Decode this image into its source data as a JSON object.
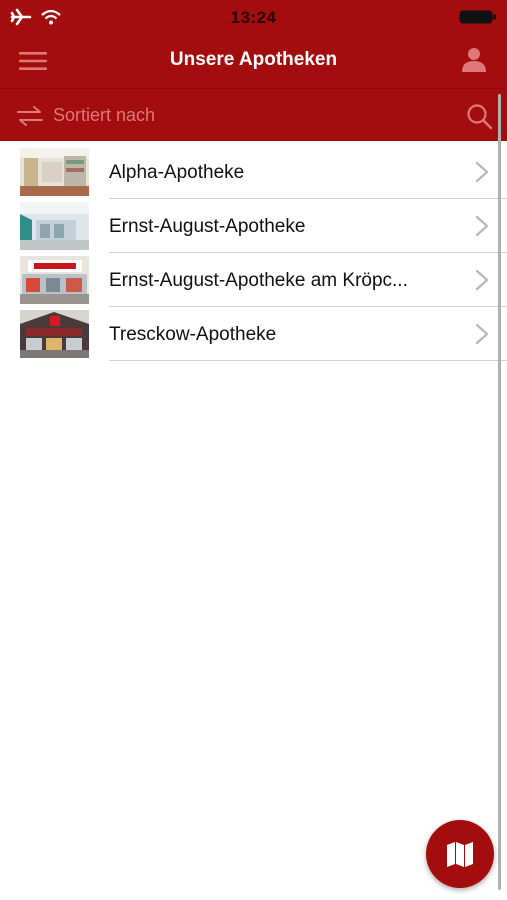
{
  "status_bar": {
    "time": "13:24",
    "icons": [
      "airplane-icon",
      "wifi-icon",
      "battery-icon"
    ]
  },
  "nav": {
    "title": "Unsere Apotheken",
    "menu_icon": "hamburger-menu-icon",
    "profile_icon": "user-profile-icon"
  },
  "sort_bar": {
    "label": "Sortiert nach",
    "sort_icon": "swap-arrows-icon",
    "search_icon": "search-icon"
  },
  "pharmacies": [
    {
      "name": "Alpha-Apotheke"
    },
    {
      "name": "Ernst-August-Apotheke"
    },
    {
      "name": "Ernst-August-Apotheke am Kröpc..."
    },
    {
      "name": "Tresckow-Apotheke"
    }
  ],
  "fab": {
    "icon": "map-icon"
  },
  "colors": {
    "brand_red": "#a30d0d",
    "sort_label": "#e0787a",
    "separator": "#d0d0d0"
  }
}
